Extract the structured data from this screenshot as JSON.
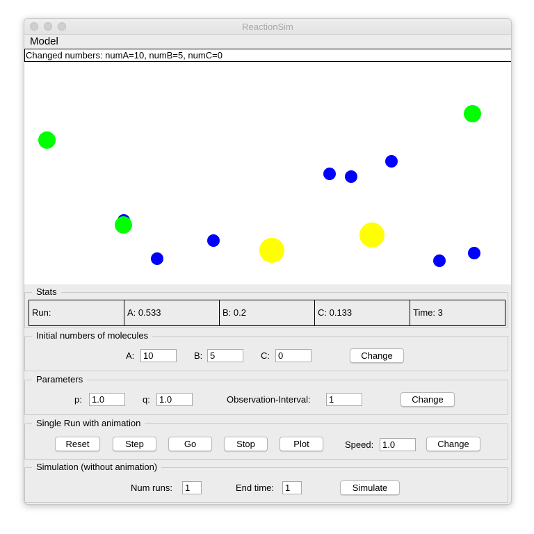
{
  "window": {
    "title": "ReactionSim"
  },
  "menubar": {
    "model_label": "Model"
  },
  "status_bar": {
    "text": "Changed numbers: numA=10, numB=5, numC=0"
  },
  "canvas": {
    "colors": {
      "A": "#0000ff",
      "B": "#00ff00",
      "C": "#ffff00"
    }
  },
  "stats": {
    "title": "Stats",
    "run": "Run:",
    "a": "A: 0.533",
    "b": "B: 0.2",
    "c": "C: 0.133",
    "time": "Time: 3"
  },
  "initial": {
    "title": "Initial numbers of molecules",
    "a_label": "A:",
    "a_value": "10",
    "b_label": "B:",
    "b_value": "5",
    "c_label": "C:",
    "c_value": "0",
    "change_label": "Change"
  },
  "parameters": {
    "title": "Parameters",
    "p_label": "p:",
    "p_value": "1.0",
    "q_label": "q:",
    "q_value": "1.0",
    "interval_label": "Observation-Interval:",
    "interval_value": "1",
    "change_label": "Change"
  },
  "single_run": {
    "title": "Single Run with animation",
    "reset_label": "Reset",
    "step_label": "Step",
    "go_label": "Go",
    "stop_label": "Stop",
    "plot_label": "Plot",
    "speed_label": "Speed:",
    "speed_value": "1.0",
    "change_label": "Change"
  },
  "simulation": {
    "title": "Simulation (without animation)",
    "runs_label": "Num runs:",
    "runs_value": "1",
    "end_label": "End time:",
    "end_value": "1",
    "simulate_label": "Simulate"
  }
}
